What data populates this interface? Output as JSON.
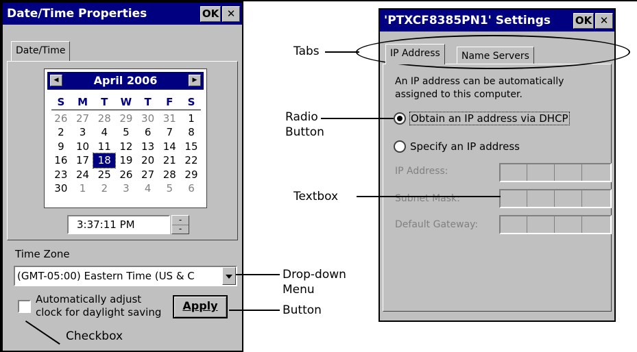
{
  "left_window": {
    "title": "Date/Time Properties",
    "ok_label": "OK",
    "close_label": "✕",
    "tab_label": "Date/Time",
    "calendar": {
      "month_label": "April 2006",
      "prev_arrow": "◀",
      "next_arrow": "▶",
      "days_of_week": [
        "S",
        "M",
        "T",
        "W",
        "T",
        "F",
        "S"
      ],
      "weeks": [
        [
          "26",
          "27",
          "28",
          "29",
          "30",
          "31",
          "1"
        ],
        [
          "2",
          "3",
          "4",
          "5",
          "6",
          "7",
          "8"
        ],
        [
          "9",
          "10",
          "11",
          "12",
          "13",
          "14",
          "15"
        ],
        [
          "16",
          "17",
          "18",
          "19",
          "20",
          "21",
          "22"
        ],
        [
          "23",
          "24",
          "25",
          "26",
          "27",
          "28",
          "29"
        ],
        [
          "30",
          "1",
          "2",
          "3",
          "4",
          "5",
          "6"
        ]
      ],
      "selected_day": "18"
    },
    "time_value": "3:37:11 PM",
    "time_zone_label": "Time Zone",
    "time_zone_value": "(GMT-05:00) Eastern Time (US & C",
    "auto_adjust_line1": "Automatically adjust",
    "auto_adjust_line2": "clock for daylight saving",
    "apply_label": "Apply"
  },
  "right_window": {
    "title": "'PTXCF8385PN1' Settings",
    "ok_label": "OK",
    "close_label": "✕",
    "tabs": [
      "IP Address",
      "Name Servers"
    ],
    "description_line1": "An IP address can be automatically",
    "description_line2": "assigned to this computer.",
    "radio_dhcp": "Obtain an IP address via DHCP",
    "radio_specify": "Specify an IP address",
    "ip_address_label": "IP Address:",
    "subnet_mask_label": "Subnet Mask:",
    "default_gateway_label": "Default Gateway:"
  },
  "annotations": {
    "tabs": "Tabs",
    "radio_line1": "Radio",
    "radio_line2": "Button",
    "textbox": "Textbox",
    "dropdown_line1": "Drop-down",
    "dropdown_line2": "Menu",
    "button": "Button",
    "checkbox": "Checkbox"
  }
}
